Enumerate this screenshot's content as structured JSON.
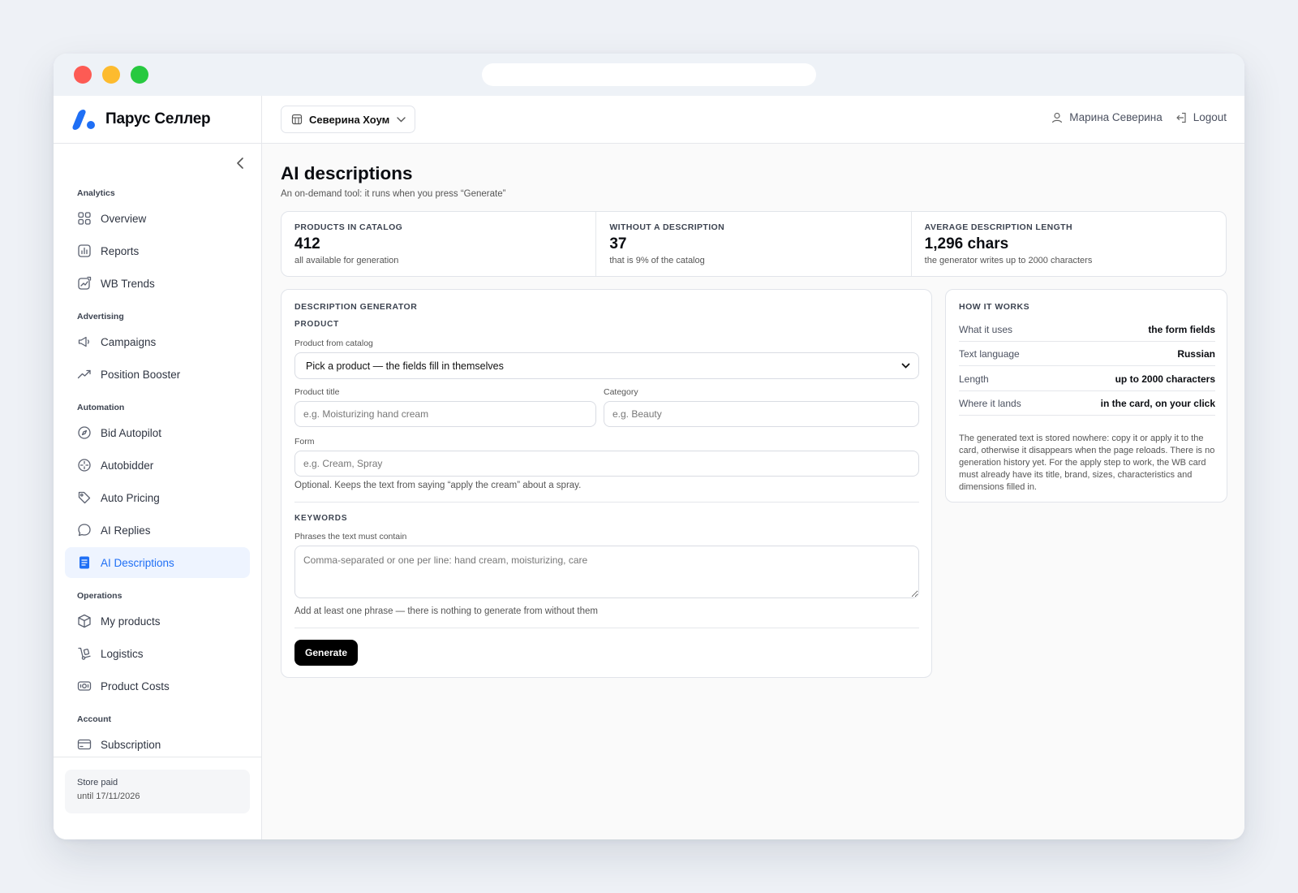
{
  "brand": {
    "name": "Парус Селлер"
  },
  "header": {
    "store": "Северина Хоум",
    "user": "Марина Северина",
    "logout": "Logout"
  },
  "sidebar": {
    "sections": [
      {
        "title": "Analytics",
        "items": [
          {
            "label": "Overview",
            "icon": "grid-icon"
          },
          {
            "label": "Reports",
            "icon": "bar-chart-icon"
          },
          {
            "label": "WB Trends",
            "icon": "trend-image-icon"
          }
        ]
      },
      {
        "title": "Advertising",
        "items": [
          {
            "label": "Campaigns",
            "icon": "megaphone-icon"
          },
          {
            "label": "Position Booster",
            "icon": "trending-up-icon"
          }
        ]
      },
      {
        "title": "Automation",
        "items": [
          {
            "label": "Bid Autopilot",
            "icon": "compass-icon"
          },
          {
            "label": "Autobidder",
            "icon": "crosshair-icon"
          },
          {
            "label": "Auto Pricing",
            "icon": "tag-icon"
          },
          {
            "label": "AI Replies",
            "icon": "chat-bubble-icon"
          },
          {
            "label": "AI Descriptions",
            "icon": "document-icon",
            "active": true
          }
        ]
      },
      {
        "title": "Operations",
        "items": [
          {
            "label": "My products",
            "icon": "box-icon"
          },
          {
            "label": "Logistics",
            "icon": "dolly-icon"
          },
          {
            "label": "Product Costs",
            "icon": "cash-icon"
          }
        ]
      },
      {
        "title": "Account",
        "items": [
          {
            "label": "Subscription",
            "icon": "credit-card-icon"
          }
        ]
      }
    ],
    "footer": {
      "status": "Store paid",
      "until": "until 17/11/2026"
    }
  },
  "page": {
    "title": "AI descriptions",
    "subtitle": "An on-demand tool: it runs when you press “Generate”"
  },
  "stats": [
    {
      "label": "PRODUCTS IN CATALOG",
      "value": "412",
      "note": "all available for generation"
    },
    {
      "label": "WITHOUT A DESCRIPTION",
      "value": "37",
      "note": "that is 9% of the catalog"
    },
    {
      "label": "AVERAGE DESCRIPTION LENGTH",
      "value": "1,296 chars",
      "note": "the generator writes up to 2000 characters"
    }
  ],
  "generator": {
    "title": "DESCRIPTION GENERATOR",
    "product_section": "PRODUCT",
    "catalog_label": "Product from catalog",
    "catalog_value": "Pick a product — the fields fill in themselves",
    "title_label": "Product title",
    "title_placeholder": "e.g. Moisturizing hand cream",
    "category_label": "Category",
    "category_placeholder": "e.g. Beauty",
    "form_label": "Form",
    "form_placeholder": "e.g. Cream, Spray",
    "form_hint": "Optional. Keeps the text from saying “apply the cream” about a spray.",
    "keywords_section": "KEYWORDS",
    "keywords_label": "Phrases the text must contain",
    "keywords_placeholder": "Comma-separated or one per line: hand cream, moisturizing, care",
    "keywords_hint": "Add at least one phrase — there is nothing to generate from without them",
    "button": "Generate"
  },
  "how": {
    "title": "HOW IT WORKS",
    "rows": [
      {
        "k": "What it uses",
        "v": "the form fields"
      },
      {
        "k": "Text language",
        "v": "Russian"
      },
      {
        "k": "Length",
        "v": "up to 2000 characters"
      },
      {
        "k": "Where it lands",
        "v": "in the card, on your click"
      }
    ],
    "note": "The generated text is stored nowhere: copy it or apply it to the card, otherwise it disappears when the page reloads. There is no generation history yet. For the apply step to work, the WB card must already have its title, brand, sizes, characteristics and dimensions filled in."
  },
  "colors": {
    "accent": "#1f6ff5",
    "button": "#000000",
    "active_bg": "#eef4ff"
  }
}
